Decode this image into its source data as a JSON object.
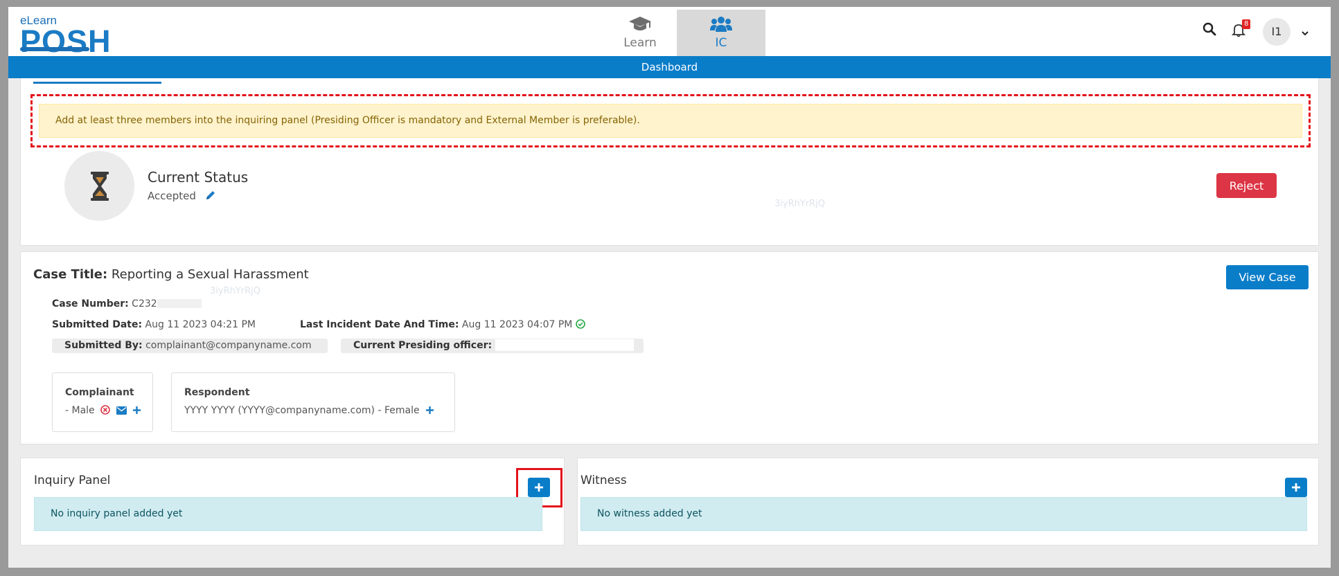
{
  "logo": {
    "small": "eLearn",
    "big": "POSH"
  },
  "nav": {
    "tabs": [
      {
        "label": "Learn",
        "icon": "graduation-cap-icon"
      },
      {
        "label": "IC",
        "icon": "users-icon",
        "active": true
      }
    ],
    "notification_count": "8",
    "avatar_initials": "I1"
  },
  "dashboard_label": "Dashboard",
  "alert": {
    "message": "Add at least three members into the inquiring panel (Presiding Officer is mandatory and External Member is preferable)."
  },
  "status": {
    "title": "Current Status",
    "value": "Accepted",
    "reject_label": "Reject",
    "watermark": "3iyRhYrRjQ"
  },
  "case": {
    "title_label": "Case Title:",
    "title": "Reporting a Sexual Harassment",
    "view_label": "View Case",
    "number_label": "Case Number:",
    "number": "C232",
    "submitted_date_label": "Submitted Date:",
    "submitted_date": "Aug 11 2023 04:21 PM",
    "incident_label": "Last Incident Date And Time:",
    "incident_date": "Aug 11 2023 04:07 PM",
    "submitted_by_label": "Submitted By:",
    "submitted_by": "complainant@companyname.com",
    "presiding_label": "Current Presiding officer:",
    "watermark": "3iyRhYrRjQ",
    "complainant": {
      "heading": "Complainant",
      "text": "- Male"
    },
    "respondent": {
      "heading": "Respondent",
      "text": "YYYY YYYY (YYYY@companyname.com) - Female"
    }
  },
  "inquiry": {
    "title": "Inquiry Panel",
    "empty": "No inquiry panel added yet"
  },
  "witness": {
    "title": "Witness",
    "empty": "No witness added yet"
  },
  "colors": {
    "primary": "#0a7dc9",
    "danger": "#dc3545",
    "warning_bg": "#fff3cd",
    "info_bg": "#d1ecf1",
    "highlight": "#e3121b"
  }
}
